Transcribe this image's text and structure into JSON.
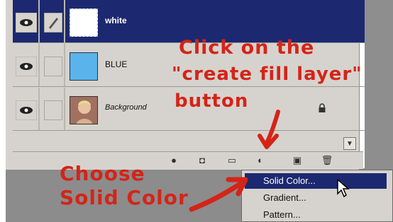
{
  "layers": [
    {
      "name": "white",
      "thumb": "white",
      "selected": true
    },
    {
      "name": "BLUE",
      "thumb": "blue",
      "selected": false
    },
    {
      "name": "Background",
      "thumb": "photo",
      "selected": false,
      "locked": true
    }
  ],
  "icons": {
    "eye": "eye-icon",
    "brush": "brush-icon",
    "lock": "lock-icon",
    "scroll_down": "scroll-down-arrow-icon"
  },
  "menu": {
    "items": [
      {
        "label": "Solid Color...",
        "highlighted": true
      },
      {
        "label": "Gradient...",
        "highlighted": false
      },
      {
        "label": "Pattern...",
        "highlighted": false
      }
    ]
  },
  "annotations": {
    "line1": "Click on the",
    "line2": "\"create fill layer\"",
    "line3": "button",
    "line4": "Choose",
    "line5": "Solid Color"
  },
  "colors": {
    "selection": "#1c2970",
    "annotation": "#d42418",
    "panel": "#d6d3ce",
    "blue_swatch": "#5ab3ea"
  }
}
